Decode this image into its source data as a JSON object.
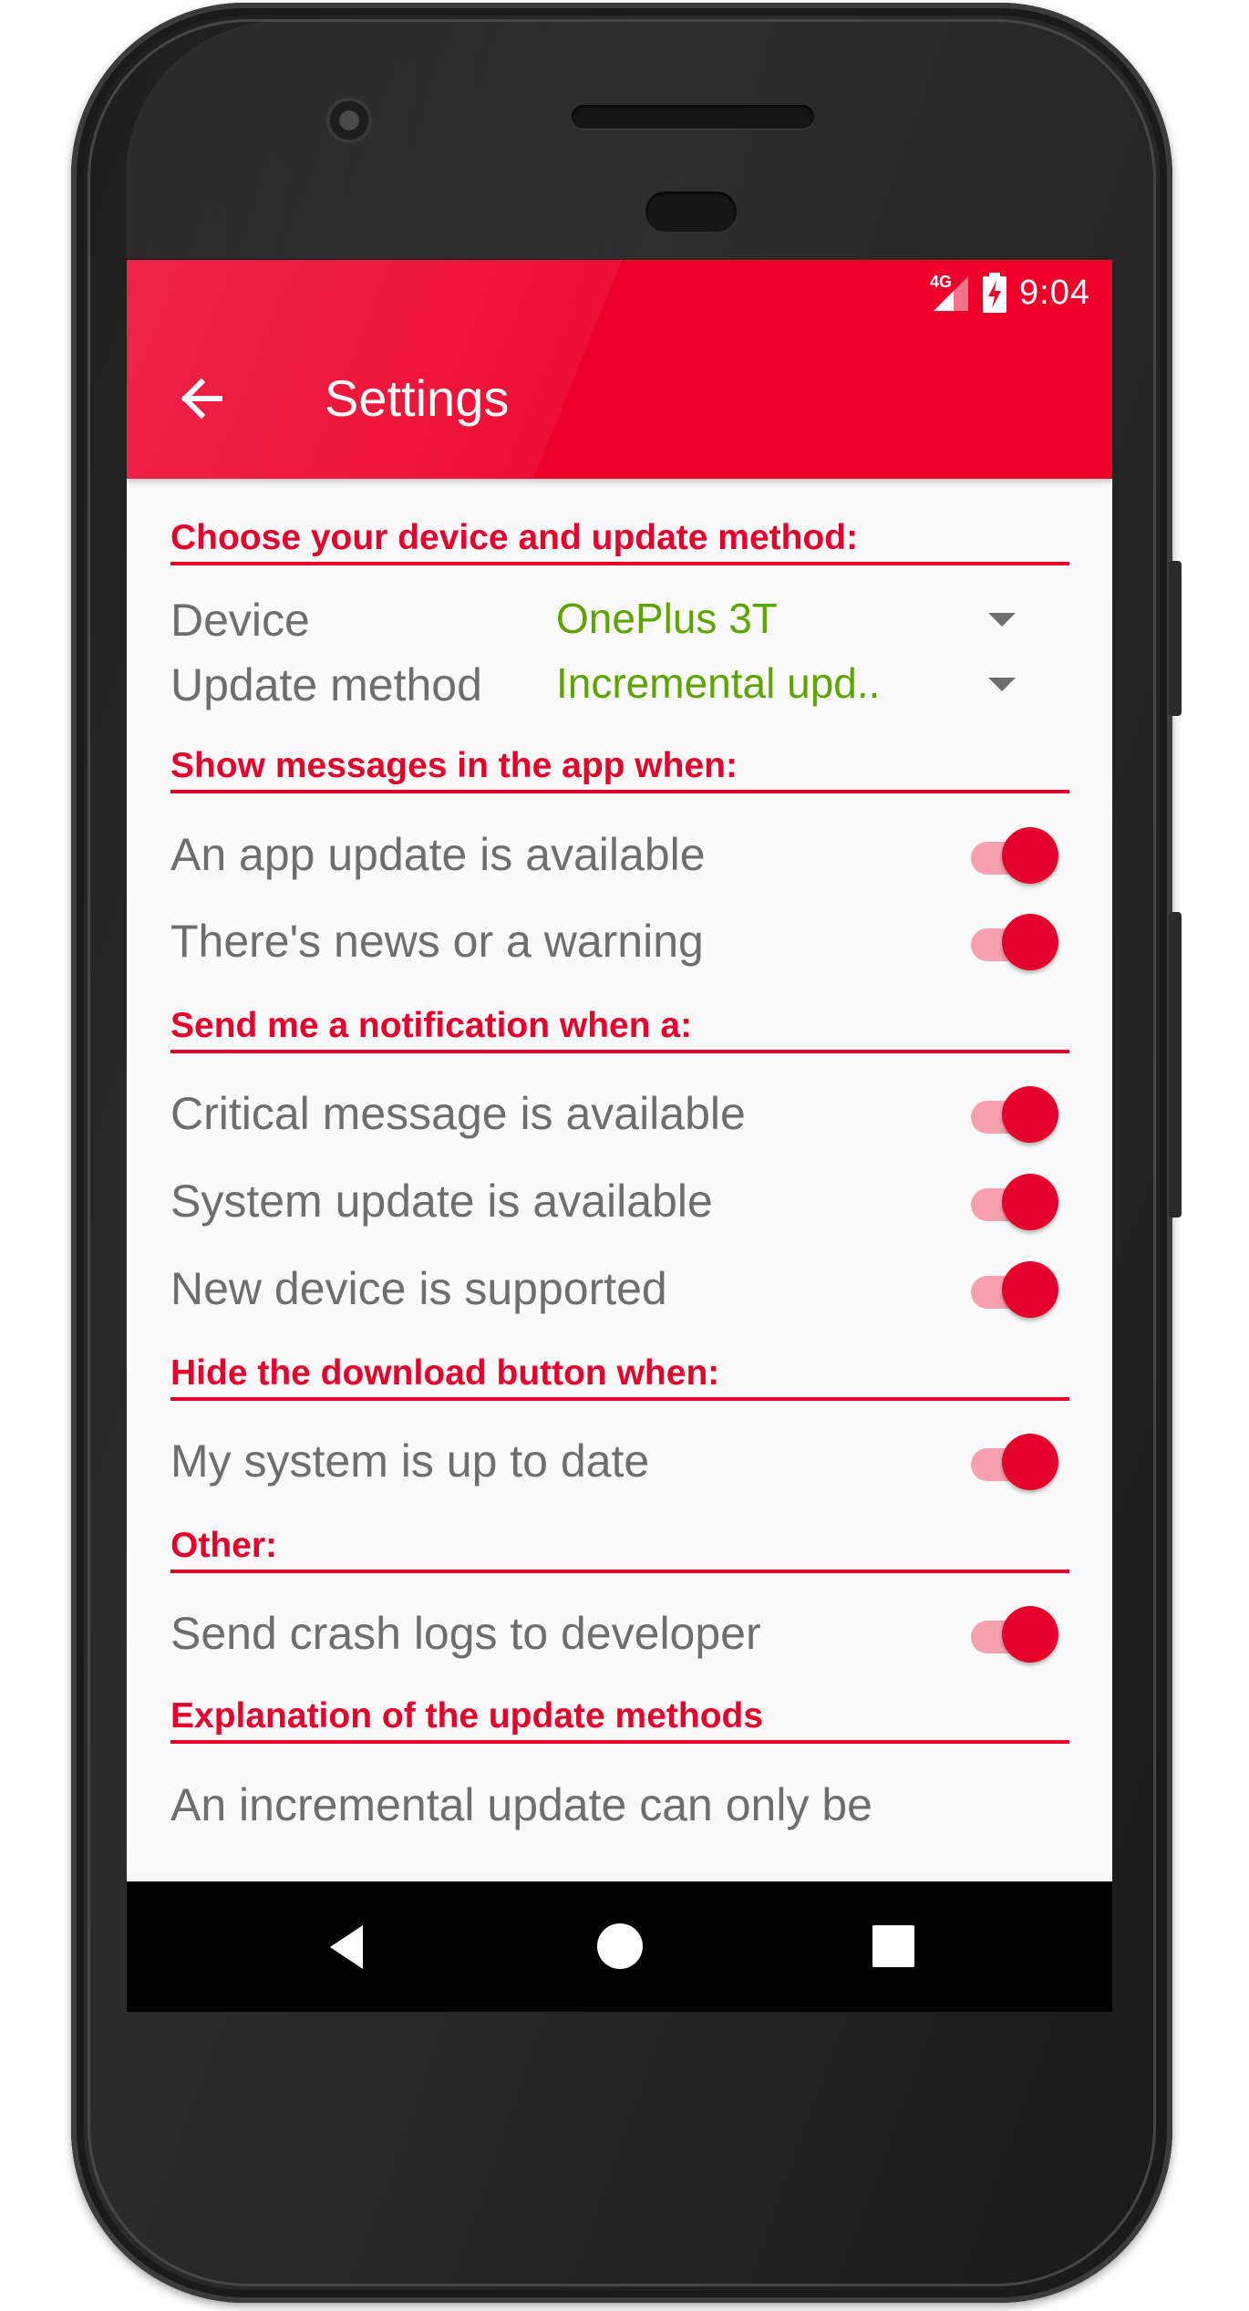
{
  "status_bar": {
    "network": "4G",
    "time": "9:04"
  },
  "toolbar": {
    "title": "Settings",
    "back_icon": "arrow-back-icon"
  },
  "colors": {
    "accent": "#e5002b",
    "appbar": "#ec0029",
    "dropdown_value": "#5ea400",
    "label": "#6e6e6e"
  },
  "sections": {
    "device": {
      "title": "Choose your device and update method:",
      "device_label": "Device",
      "device_value": "OnePlus 3T",
      "method_label": "Update method",
      "method_value": "Incremental upd.."
    },
    "messages": {
      "title": "Show messages in the app when:",
      "items": [
        {
          "label": "An app update is available",
          "on": true
        },
        {
          "label": "There's news or a warning",
          "on": true
        }
      ]
    },
    "notifications": {
      "title": "Send me a notification when a:",
      "items": [
        {
          "label": "Critical message is available",
          "on": true
        },
        {
          "label": "System update is available",
          "on": true
        },
        {
          "label": "New device is supported",
          "on": true
        }
      ]
    },
    "download": {
      "title": "Hide the download button when:",
      "items": [
        {
          "label": "My system is up to date",
          "on": true
        }
      ]
    },
    "other": {
      "title": "Other:",
      "items": [
        {
          "label": "Send crash logs to developer",
          "on": true
        }
      ]
    },
    "explanation": {
      "title": "Explanation of the update methods",
      "text": "An incremental update can only be"
    }
  },
  "nav_bar": {
    "back": "back-triangle-icon",
    "home": "home-circle-icon",
    "recents": "recents-square-icon"
  }
}
